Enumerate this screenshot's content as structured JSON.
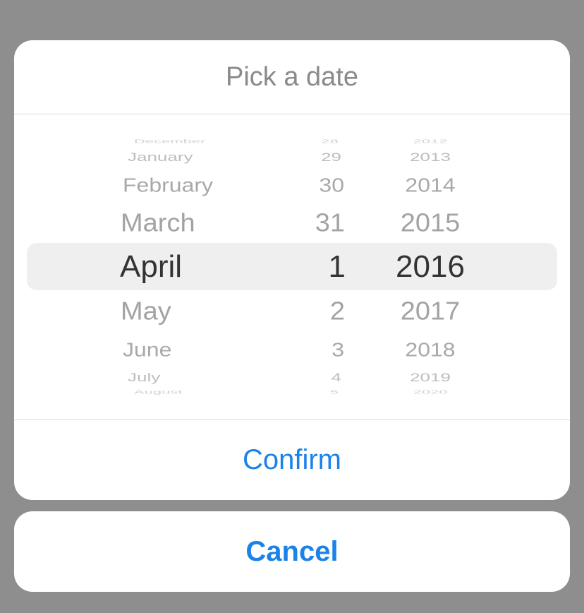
{
  "dialog": {
    "title": "Pick a date",
    "confirm_label": "Confirm",
    "cancel_label": "Cancel",
    "accent_color": "#1a82e8"
  },
  "picker": {
    "selected": {
      "month": "April",
      "day": "1",
      "year": "2016"
    },
    "rows": [
      {
        "month": "December",
        "day": "28",
        "year": "2012"
      },
      {
        "month": "January",
        "day": "29",
        "year": "2013"
      },
      {
        "month": "February",
        "day": "30",
        "year": "2014"
      },
      {
        "month": "March",
        "day": "31",
        "year": "2015"
      },
      {
        "month": "April",
        "day": "1",
        "year": "2016"
      },
      {
        "month": "May",
        "day": "2",
        "year": "2017"
      },
      {
        "month": "June",
        "day": "3",
        "year": "2018"
      },
      {
        "month": "July",
        "day": "4",
        "year": "2019"
      },
      {
        "month": "August",
        "day": "5",
        "year": "2020"
      }
    ]
  }
}
